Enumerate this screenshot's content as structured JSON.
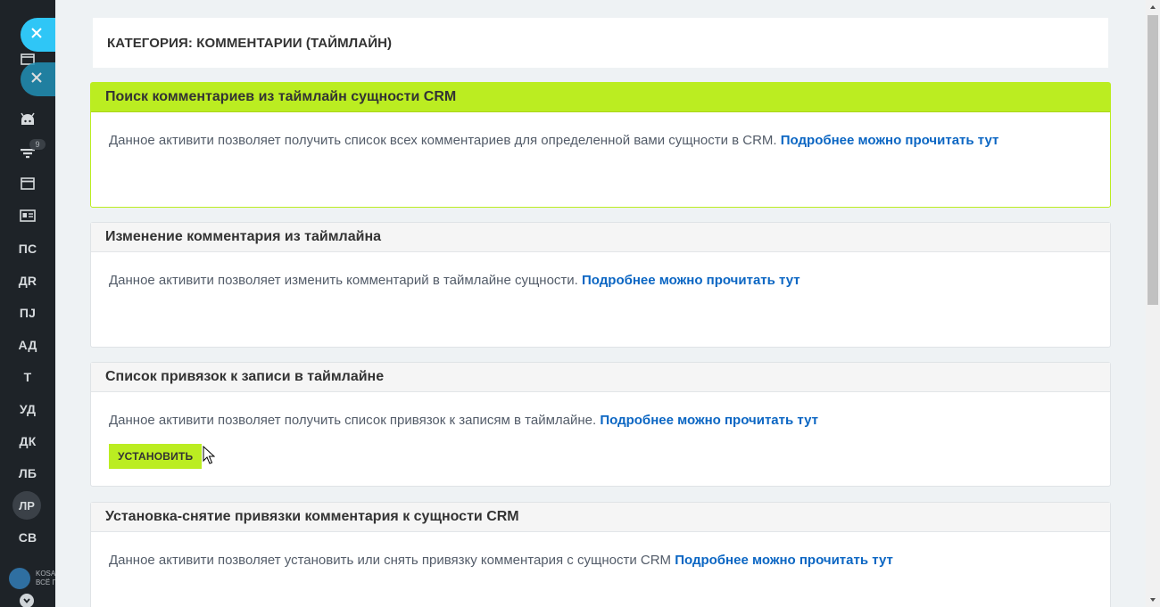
{
  "sidebar": {
    "labels": [
      "ПС",
      "ДR",
      "ПJ",
      "АД",
      "Т",
      "УД",
      "ДК",
      "ЛБ",
      "СВ"
    ],
    "badge": "9",
    "avatar": "ЛР",
    "logo_text_1": "KOSA",
    "logo_text_2": "ВСЁ П"
  },
  "page": {
    "category_title": "КАТЕГОРИЯ: КОММЕНТАРИИ (ТАЙМЛАЙН)"
  },
  "cards": [
    {
      "title": "Поиск комментариев из таймлайн сущности CRM",
      "description": "Данное активити позволяет получить список всех комментариев для определенной вами сущности в CRM.",
      "link": "Подробнее можно прочитать тут"
    },
    {
      "title": "Изменение комментария из таймлайна",
      "description": "Данное активити позволяет изменить комментарий в таймлайне сущности.",
      "link": "Подробнее можно прочитать тут"
    },
    {
      "title": "Список привязок к записи в таймлайне",
      "description": "Данное активити позволяет получить список привязок к записям в таймлайне.",
      "link": "Подробнее можно прочитать тут",
      "button": "УСТАНОВИТЬ"
    },
    {
      "title": "Установка-снятие привязки комментария к сущности CRM",
      "description": "Данное активити позволяет установить или снять привязку комментария с сущности CRM",
      "link": "Подробнее можно прочитать тут"
    }
  ],
  "colors": {
    "accent_green": "#bbed21",
    "link_blue": "#0b66c3",
    "close_blue": "#2fc6f6",
    "sidebar_bg": "#1e2328"
  },
  "icons": [
    "close-icon",
    "android-icon",
    "filter-icon",
    "window-icon",
    "contact-card-icon",
    "calendar-icon",
    "chevron-down-icon",
    "arrow-up-icon",
    "arrow-down-icon"
  ]
}
